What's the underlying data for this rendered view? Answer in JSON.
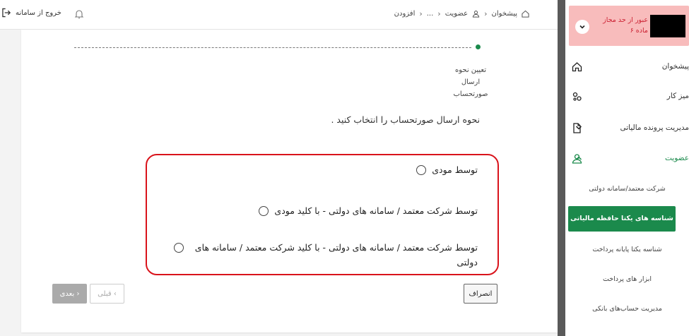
{
  "topbar": {
    "logout_label": "خروج از سامانه",
    "breadcrumb": [
      "پیشخوان",
      "عضویت",
      "...",
      "افزودن"
    ]
  },
  "stepper": {
    "step_label": "تعیین نحوه ارسال صورتحساب"
  },
  "form": {
    "question": "نحوه ارسال صورتحساب را انتخاب کنید .",
    "options": [
      "توسط مودی",
      "توسط شرکت معتمد / سامانه های دولتی - با کلید مودی",
      "توسط شرکت معتمد / سامانه های دولتی - با کلید شرکت معتمد / سامانه های دولتی"
    ],
    "cancel_label": "انصراف",
    "prev_label": "قبلی",
    "next_label": "بعدی"
  },
  "sidebar": {
    "alert_text": "عبور از حد مجاز ماده ۶",
    "items": [
      {
        "label": "پیشخوان",
        "icon": "home-icon"
      },
      {
        "label": "میز کار",
        "icon": "workspace-icon"
      },
      {
        "label": "مدیریت پرونده مالیاتی",
        "icon": "document-icon"
      },
      {
        "label": "عضویت",
        "icon": "user-icon"
      }
    ],
    "sub_items": [
      "شرکت معتمد/سامانه دولتی",
      "شناسه های یکتا حافظه مالیاتی",
      "شناسه یکتا پایانه پرداخت",
      "ابزار های پرداخت",
      "مدیریت حساب‌های بانکی"
    ]
  },
  "colors": {
    "accent": "#1b8a4c",
    "highlight_border": "#d9131b",
    "alert_bg": "#f8bcbc"
  }
}
